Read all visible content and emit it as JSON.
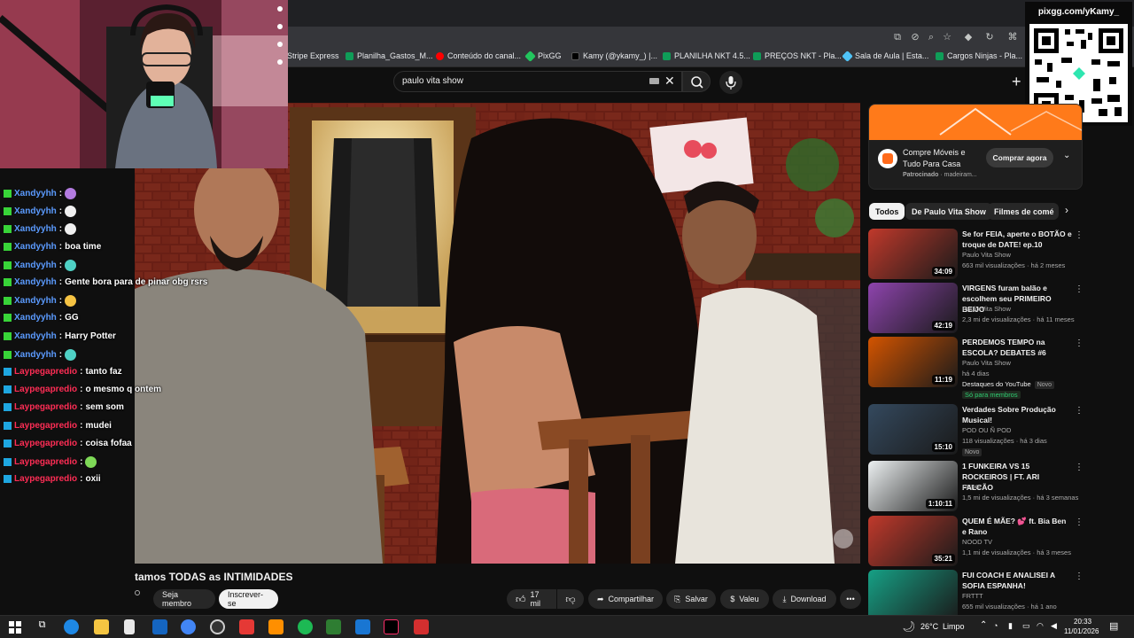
{
  "overlay": {
    "qr_text": "pixgg.com/yKamy_"
  },
  "browser": {
    "bookmarks": [
      {
        "label": "Stripe Express",
        "color": "#ffffff"
      },
      {
        "label": "Planilha_Gastos_M...",
        "color": "#0f9d58"
      },
      {
        "label": "Conteúdo do canal...",
        "color": "#ff0000"
      },
      {
        "label": "PixGG",
        "color": "#22c55e"
      },
      {
        "label": "Kamy (@ykamy_) |...",
        "color": "#000000"
      },
      {
        "label": "PLANILHA NKT 4.5...",
        "color": "#0f9d58"
      },
      {
        "label": "PREÇOS NKT - Pla...",
        "color": "#0f9d58"
      },
      {
        "label": "Sala de Aula | Esta...",
        "color": "#4fc3f7"
      },
      {
        "label": "Cargos Ninjas - Pla...",
        "color": "#0f9d58"
      }
    ]
  },
  "youtube": {
    "search_value": "paulo vita show",
    "video_title": "tamos TODAS as INTIMIDADES",
    "join_label": "Seja membro",
    "subscribe_label": "Inscrever-se",
    "like_count": "17 mil",
    "share_label": "Compartilhar",
    "save_label": "Salvar",
    "thanks_label": "Valeu",
    "download_label": "Download",
    "ad": {
      "title": "Compre Móveis e Tudo Para Casa",
      "sponsored": "Patrocinado",
      "domain": "· madeiram...",
      "cta": "Comprar agora"
    },
    "chips": [
      "Todos",
      "De Paulo Vita Show",
      "Filmes de comé"
    ],
    "recs": [
      {
        "title": "Se for FEIA, aperte o BOTÃO e troque de DATE! ep.10",
        "channel": "Paulo Vita Show",
        "stats": "663 mil visualizações · há 2 meses",
        "duration": "34:09",
        "thumb": "#c0392b"
      },
      {
        "title": "VIRGENS furam balão e escolhem seu PRIMEIRO BEIJO",
        "channel": "Paulo Vita Show",
        "stats": "2,3 mi de visualizações · há 11 meses",
        "duration": "42:19",
        "thumb": "#8e44ad"
      },
      {
        "title": "PERDEMOS TEMPO na ESCOLA? DEBATES #6",
        "channel": "Paulo Vita Show",
        "stats": "há 4 dias",
        "extra": "Destaques do YouTube",
        "tag": "Novo",
        "members": "Só para membros",
        "duration": "11:19",
        "thumb": "#d35400"
      },
      {
        "title": "Verdades Sobre Produção Musical!",
        "channel": "POD OU Ñ POD",
        "stats": "118 visualizações · há 3 dias",
        "tag": "Novo",
        "duration": "15:10",
        "thumb": "#34495e"
      },
      {
        "title": "1 FUNKEIRA VS 15 ROCKEIROS | FT. ARI FALCÃO",
        "channel": "PEIXE",
        "stats": "1,5 mi de visualizações · há 3 semanas",
        "duration": "1:10:11",
        "thumb": "#ecf0f1"
      },
      {
        "title": "QUEM É MÃE? 💕 ft. Bia Ben e Rano",
        "channel": "NOOD TV",
        "stats": "1,1 mi de visualizações · há 3 meses",
        "duration": "35:21",
        "thumb": "#c0392b"
      },
      {
        "title": "FUI COACH E ANALISEI A SOFIA ESPANHA!",
        "channel": "FRTTT",
        "stats": "655 mil visualizações · há 1 ano",
        "duration": "",
        "thumb": "#16a085"
      }
    ]
  },
  "chat": [
    {
      "user": "Xandyyhh",
      "msg": "",
      "emote": "emote-1",
      "color": "#5b9bff",
      "badge": "#38d438"
    },
    {
      "user": "Xandyyhh",
      "msg": "",
      "emote": "emote-2",
      "color": "#5b9bff",
      "badge": "#38d438"
    },
    {
      "user": "Xandyyhh",
      "msg": "",
      "emote": "emote-2",
      "color": "#5b9bff",
      "badge": "#38d438"
    },
    {
      "user": "Xandyyhh",
      "msg": "boa time",
      "emote": "",
      "color": "#5b9bff",
      "badge": "#38d438"
    },
    {
      "user": "Xandyyhh",
      "msg": "",
      "emote": "emote-3",
      "color": "#5b9bff",
      "badge": "#38d438"
    },
    {
      "user": "Xandyyhh",
      "msg": "Gente bora para de pinar obg rsrs",
      "emote": "",
      "color": "#5b9bff",
      "badge": "#38d438"
    },
    {
      "user": "Xandyyhh",
      "msg": "",
      "emote": "emote-4",
      "color": "#5b9bff",
      "badge": "#38d438"
    },
    {
      "user": "Xandyyhh",
      "msg": "GG",
      "emote": "",
      "color": "#5b9bff",
      "badge": "#38d438"
    },
    {
      "user": "Xandyyhh",
      "msg": "Harry Potter",
      "emote": "",
      "color": "#5b9bff",
      "badge": "#38d438"
    },
    {
      "user": "Xandyyhh",
      "msg": "",
      "emote": "emote-3",
      "color": "#5b9bff",
      "badge": "#38d438"
    },
    {
      "user": "Laypegapredio",
      "msg": "tanto faz",
      "emote": "",
      "color": "#ff2d55",
      "badge": "#1ea7e1"
    },
    {
      "user": "Laypegapredio",
      "msg": "o mesmo q ontem",
      "emote": "",
      "color": "#ff2d55",
      "badge": "#1ea7e1"
    },
    {
      "user": "Laypegapredio",
      "msg": "sem som",
      "emote": "",
      "color": "#ff2d55",
      "badge": "#1ea7e1"
    },
    {
      "user": "Laypegapredio",
      "msg": "mudei",
      "emote": "",
      "color": "#ff2d55",
      "badge": "#1ea7e1"
    },
    {
      "user": "Laypegapredio",
      "msg": "coisa fofaa",
      "emote": "",
      "color": "#ff2d55",
      "badge": "#1ea7e1"
    },
    {
      "user": "Laypegapredio",
      "msg": "",
      "emote": "emote-5",
      "color": "#ff2d55",
      "badge": "#1ea7e1"
    },
    {
      "user": "Laypegapredio",
      "msg": "oxii",
      "emote": "",
      "color": "#ff2d55",
      "badge": "#1ea7e1"
    }
  ],
  "taskbar": {
    "weather_temp": "26°C",
    "weather_text": "Limpo",
    "time": "20:33",
    "date": "11/01/2026"
  }
}
